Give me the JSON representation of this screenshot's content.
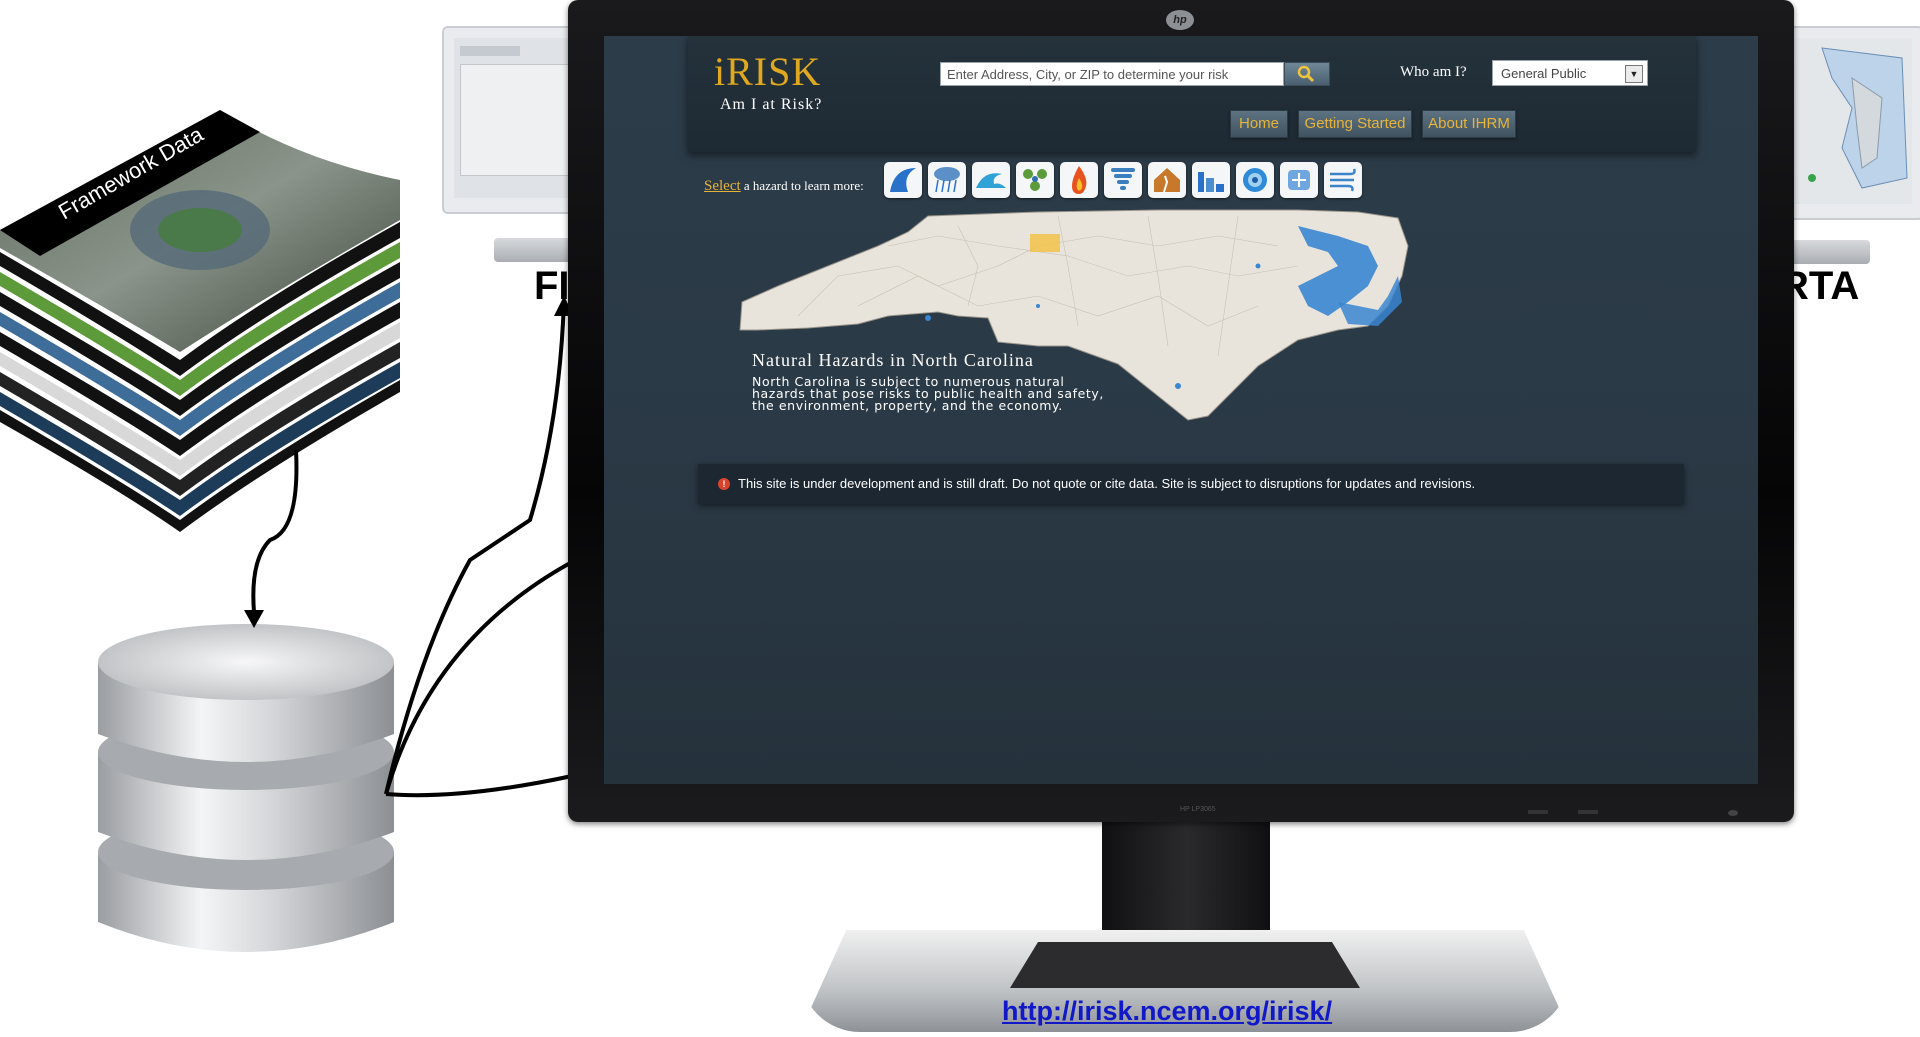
{
  "left_monitor": {
    "label": "FI"
  },
  "right_monitor": {
    "label": "RTA"
  },
  "layer_stack": {
    "label": "Framework Data"
  },
  "app": {
    "logo": "iRISK",
    "tagline": "Am I at Risk?",
    "search": {
      "placeholder": "Enter Address, City, or ZIP to determine your risk"
    },
    "whoami_label": "Who am I?",
    "role": {
      "selected": "General Public"
    },
    "nav": [
      {
        "label": "Home"
      },
      {
        "label": "Getting Started"
      },
      {
        "label": "About IHRM"
      }
    ],
    "select_link": "Select",
    "select_rest": " a hazard to learn more:",
    "hazards": [
      "tsunami-icon",
      "flood-icon",
      "coastal-surge-icon",
      "drought-icon",
      "wildfire-icon",
      "tornado-icon",
      "earthquake-icon",
      "dam-failure-icon",
      "hurricane-icon",
      "winter-storm-icon",
      "wind-icon"
    ],
    "section_title": "Natural Hazards in North Carolina",
    "section_body": "North Carolina is subject to numerous natural hazards that pose risks to public health and safety, the environment, property, and the economy.",
    "notice": "This site is under development and is still draft. Do not quote or cite data. Site is subject to disruptions for updates and revisions.",
    "colors": {
      "accent": "#e0a81f",
      "background": "#2b3a46",
      "water": "#3a86d0",
      "land": "#e8e4dc"
    }
  },
  "monitor_model": "HP LP3065",
  "url": "http://irisk.ncem.org/irisk/"
}
